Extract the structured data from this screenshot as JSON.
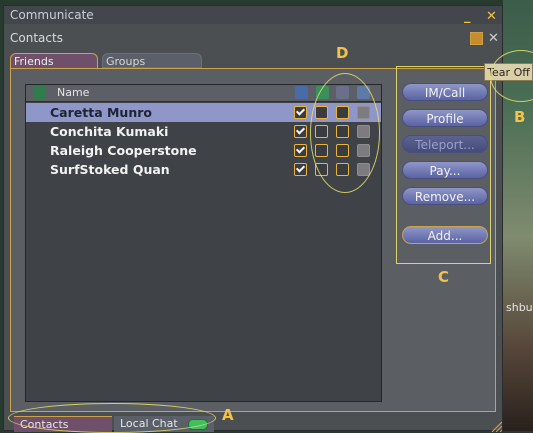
{
  "window": {
    "title": "Communicate",
    "subtitle": "Contacts",
    "minimize_glyph": "_",
    "close_glyph": "✕"
  },
  "tabs": [
    {
      "label": "Friends"
    },
    {
      "label": "Groups"
    }
  ],
  "list": {
    "header": {
      "name": "Name"
    },
    "rows": [
      {
        "name": "Caretta Munro",
        "selected": true
      },
      {
        "name": "Conchita Kumaki",
        "selected": false
      },
      {
        "name": "Raleigh Cooperstone",
        "selected": false
      },
      {
        "name": "SurfStoked Quan",
        "selected": false
      }
    ]
  },
  "buttons": [
    {
      "label": "IM/Call",
      "enabled": true
    },
    {
      "label": "Profile",
      "enabled": true
    },
    {
      "label": "Teleport...",
      "enabled": false
    },
    {
      "label": "Pay...",
      "enabled": true
    },
    {
      "label": "Remove...",
      "enabled": true
    },
    {
      "label": "Add...",
      "enabled": true
    }
  ],
  "bottom_tabs": {
    "contacts": "Contacts",
    "local_chat": "Local Chat"
  },
  "annotations": {
    "a": "A",
    "b": "B",
    "c": "C",
    "d": "D"
  },
  "tear_off": "Tear Off",
  "right_overlay_text": "shbu",
  "colors": {
    "accent": "#c9a24a",
    "selected_row": "#8f96c8",
    "button": "#6a72b4",
    "annotation": "#e8e06a"
  },
  "icons": {
    "online": "person-icon",
    "status_column_1": "online-status-icon",
    "status_column_2": "map-icon",
    "status_column_3": "edit-objects-icon",
    "status_column_4": "modify-objects-icon",
    "chat_badge": "chat-badge-icon",
    "resize": "resize-handle-icon"
  }
}
